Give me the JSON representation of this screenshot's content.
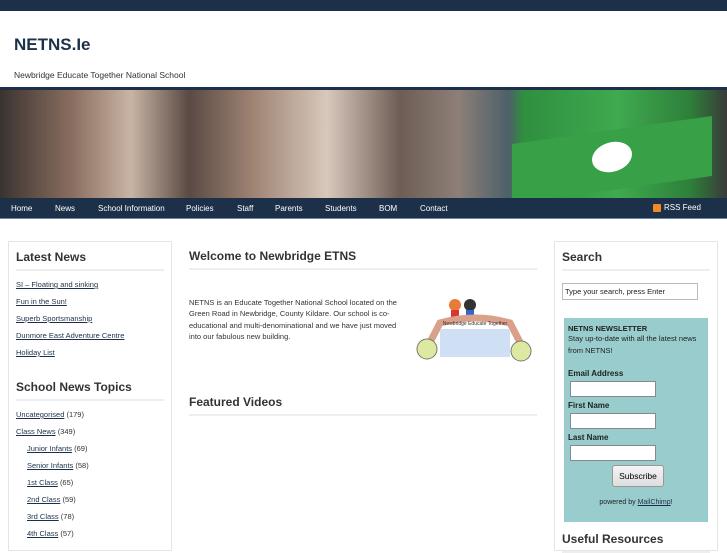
{
  "site": {
    "title": "NETNS.Ie",
    "tagline": "Newbridge Educate Together National School"
  },
  "nav": {
    "items": [
      "Home",
      "News",
      "School Information",
      "Policies",
      "Staff",
      "Parents",
      "Students",
      "BOM",
      "Contact"
    ],
    "rss": "RSS Feed"
  },
  "left": {
    "latest_title": "Latest News",
    "latest": [
      "SI – Floating and sinking",
      "Fun in the Sun!",
      "Superb Sportsmanship",
      "Dunmore East Adventure Centre",
      "Holiday List"
    ],
    "topics_title": "School News Topics",
    "topics": [
      {
        "label": "Uncategorised",
        "count": "(179)",
        "sub": false
      },
      {
        "label": "Class News",
        "count": "(349)",
        "sub": false
      },
      {
        "label": "Junior Infants",
        "count": "(69)",
        "sub": true
      },
      {
        "label": "Senior Infants",
        "count": "(58)",
        "sub": true
      },
      {
        "label": "1st Class",
        "count": "(65)",
        "sub": true
      },
      {
        "label": "2nd Class",
        "count": "(59)",
        "sub": true
      },
      {
        "label": "3rd Class",
        "count": "(78)",
        "sub": true
      },
      {
        "label": "4th Class",
        "count": "(57)",
        "sub": true
      }
    ]
  },
  "center": {
    "welcome_title": "Welcome to Newbridge ETNS",
    "welcome_text": "NETNS is an Educate Together National School located on the Green Road in Newbridge, County Kildare. Our school is co-educational and multi-denominational and we have just moved into our fabulous new building.",
    "logo_text": "Newbridge Educate Together",
    "videos_title": "Featured Videos"
  },
  "right": {
    "search_title": "Search",
    "search_value": "Type your search, press Enter",
    "newsletter": {
      "title": "NETNS NEWSLETTER",
      "desc": "Stay up-to-date with all the latest news from NETNS!",
      "email": "Email Address",
      "first": "First Name",
      "last": "Last Name",
      "subscribe": "Subscribe",
      "powered": "powered by",
      "mailchimp": "MailChimp",
      "bang": "!"
    },
    "resources_title": "Useful Resources"
  },
  "colors": {
    "navy": "#1c3149",
    "newsletter_bg": "#99cccc"
  }
}
